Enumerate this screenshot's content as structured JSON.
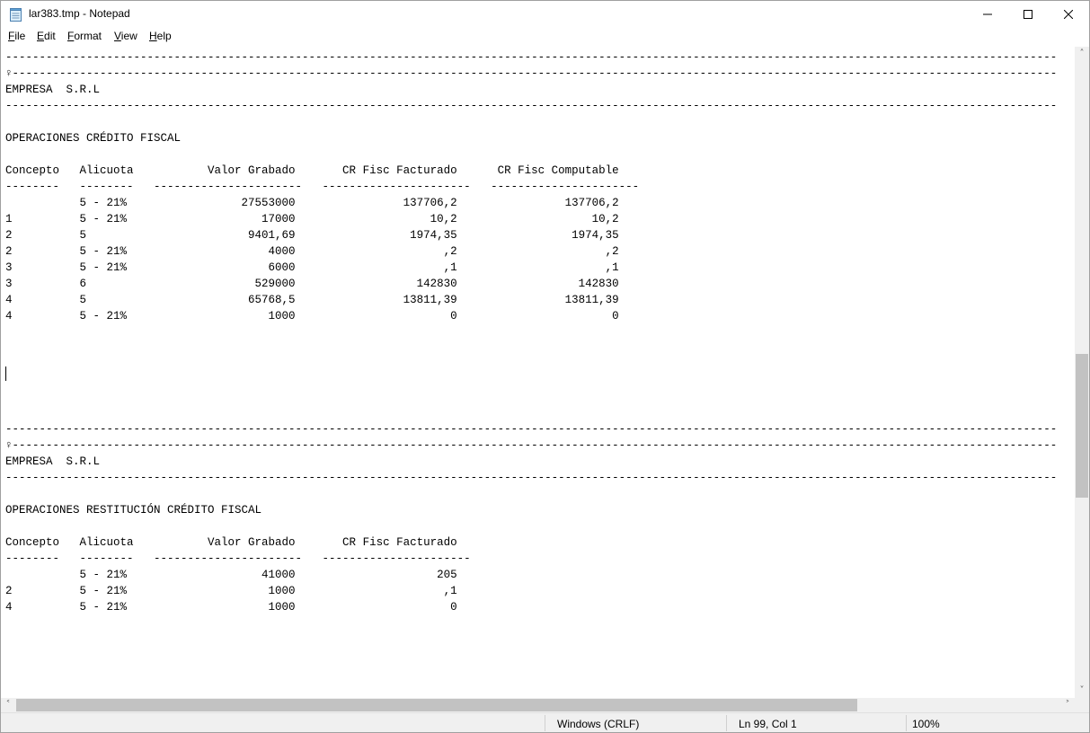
{
  "window": {
    "title": "lar383.tmp - Notepad",
    "controls": {
      "minimize": "—",
      "maximize": "☐",
      "close": "✕"
    }
  },
  "menu": {
    "file": {
      "key": "F",
      "rest": "ile"
    },
    "edit": {
      "key": "E",
      "rest": "dit"
    },
    "format": {
      "key": "F",
      "rest": "ormat",
      "prefix": ""
    },
    "view": {
      "key": "V",
      "rest": "iew"
    },
    "help": {
      "key": "H",
      "rest": "elp"
    }
  },
  "document": {
    "lines": [
      "------------------------------------------------------------------------------------------------------------------------------------------------------------",
      "♀-----------------------------------------------------------------------------------------------------------------------------------------------------------",
      "EMPRESA  S.R.L",
      "------------------------------------------------------------------------------------------------------------------------------------------------------------",
      "",
      "OPERACIONES CRÉDITO FISCAL",
      "",
      "Concepto   Alicuota           Valor Grabado       CR Fisc Facturado      CR Fisc Computable",
      "--------   --------   ----------------------   ----------------------   ----------------------",
      "           5 - 21%                 27553000                137706,2                137706,2",
      "1          5 - 21%                    17000                    10,2                    10,2",
      "2          5                        9401,69                 1974,35                 1974,35",
      "2          5 - 21%                     4000                      ,2                      ,2",
      "3          5 - 21%                     6000                      ,1                      ,1",
      "3          6                         529000                  142830                  142830",
      "4          5                        65768,5                13811,39                13811,39",
      "4          5 - 21%                     1000                       0                       0",
      "",
      "",
      "",
      "",
      "",
      "",
      "------------------------------------------------------------------------------------------------------------------------------------------------------------",
      "♀-----------------------------------------------------------------------------------------------------------------------------------------------------------",
      "EMPRESA  S.R.L",
      "------------------------------------------------------------------------------------------------------------------------------------------------------------",
      "",
      "OPERACIONES RESTITUCIÓN CRÉDITO FISCAL",
      "",
      "Concepto   Alicuota           Valor Grabado       CR Fisc Facturado",
      "--------   --------   ----------------------   ----------------------",
      "           5 - 21%                    41000                     205",
      "2          5 - 21%                     1000                      ,1",
      "4          5 - 21%                     1000                       0"
    ]
  },
  "statusbar": {
    "line_ending": "Windows (CRLF)",
    "position": "Ln 99, Col 1",
    "zoom": "100%"
  },
  "icons": {
    "app": "notepad-icon",
    "scroll_up": "˄",
    "scroll_down": "˅",
    "scroll_left": "˂",
    "scroll_right": "˃"
  }
}
